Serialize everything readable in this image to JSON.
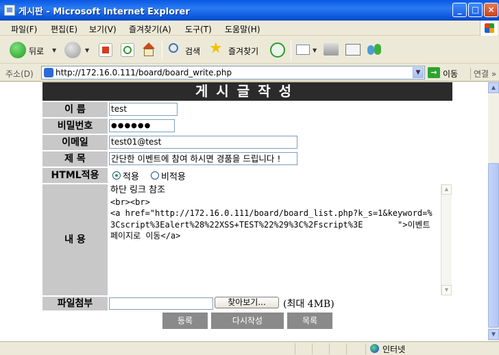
{
  "window": {
    "title": "게시판 - Microsoft Internet Explorer",
    "minimize": "_",
    "maximize": "□",
    "close": "×"
  },
  "menu": {
    "items": [
      "파일(F)",
      "편집(E)",
      "보기(V)",
      "즐겨찾기(A)",
      "도구(T)",
      "도움말(H)"
    ]
  },
  "toolbar": {
    "back_label": "뒤로",
    "search_label": "검색",
    "favorites_label": "즐겨찾기"
  },
  "address": {
    "label": "주소(D)",
    "url": "http://172.16.0.111/board/board_write.php",
    "go_label": "이동",
    "links_label": "연결 »"
  },
  "form": {
    "header": "게시글작성",
    "name_label": "이 름",
    "name_value": "test",
    "password_label": "비밀번호",
    "password_value": "●●●●●●",
    "email_label": "이메일",
    "email_value": "test01@test",
    "subject_label": "제 목",
    "subject_value": "간단한 이벤트에 참여 하시면 경품을 드립니다 !",
    "html_label": "HTML적용",
    "html_options": [
      "적용",
      "비적용"
    ],
    "html_selected": "적용",
    "content_label": "내 용",
    "content_first_line": "하단 링크 참조",
    "content_rest": "\n<br><br>\n<a href=\"http://172.16.0.111/board/board_list.php?k_s=1&keyword=%3Cscript%3Ealert%28%22XSS+TEST%22%29%3C%2Fscript%3E       \">이벤트페이지로 이동</a>",
    "file_label": "파일첨부",
    "file_value": "",
    "browse_label": "찾아보기...",
    "file_note": "(최대 4MB)",
    "buttons": {
      "submit": "등록",
      "reset": "다시작성",
      "list": "목록"
    }
  },
  "status": {
    "zone": "인터넷"
  }
}
